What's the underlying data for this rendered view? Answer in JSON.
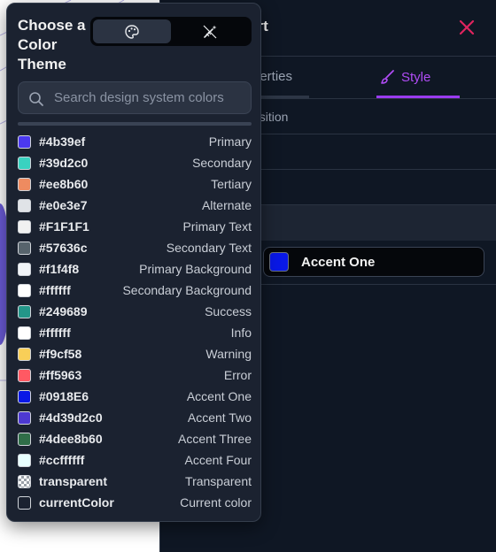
{
  "panel": {
    "title": "art",
    "tabs": [
      {
        "label": "perties"
      },
      {
        "label": "Style"
      }
    ],
    "rows": [
      {
        "label": "osition"
      },
      {
        "label": "n"
      }
    ],
    "color_field": {
      "label": "Accent One",
      "color": "#0918E6"
    }
  },
  "popover": {
    "title": "Choose a Color Theme",
    "search": {
      "placeholder": "Search design system colors",
      "value": ""
    },
    "colors": [
      {
        "hex": "#4b39ef",
        "name": "Primary",
        "swatch": "#4b39ef"
      },
      {
        "hex": "#39d2c0",
        "name": "Secondary",
        "swatch": "#39d2c0"
      },
      {
        "hex": "#ee8b60",
        "name": "Tertiary",
        "swatch": "#ee8b60"
      },
      {
        "hex": "#e0e3e7",
        "name": "Alternate",
        "swatch": "#e0e3e7"
      },
      {
        "hex": "#F1F1F1",
        "name": "Primary Text",
        "swatch": "#F1F1F1"
      },
      {
        "hex": "#57636c",
        "name": "Secondary Text",
        "swatch": "#57636c"
      },
      {
        "hex": "#f1f4f8",
        "name": "Primary Background",
        "swatch": "#f1f4f8"
      },
      {
        "hex": "#ffffff",
        "name": "Secondary Background",
        "swatch": "#ffffff"
      },
      {
        "hex": "#249689",
        "name": "Success",
        "swatch": "#249689"
      },
      {
        "hex": "#ffffff",
        "name": "Info",
        "swatch": "#ffffff"
      },
      {
        "hex": "#f9cf58",
        "name": "Warning",
        "swatch": "#f9cf58"
      },
      {
        "hex": "#ff5963",
        "name": "Error",
        "swatch": "#ff5963"
      },
      {
        "hex": "#0918E6",
        "name": "Accent One",
        "swatch": "#0918E6"
      },
      {
        "hex": "#4d39d2c0",
        "name": "Accent Two",
        "swatch": "#4d39d2"
      },
      {
        "hex": "#4dee8b60",
        "name": "Accent Three",
        "swatch": "#2f6e48"
      },
      {
        "hex": "#ccffffff",
        "name": "Accent Four",
        "swatch": "#e8ffff"
      },
      {
        "hex": "transparent",
        "name": "Transparent",
        "swatch": "checker"
      },
      {
        "hex": "currentColor",
        "name": "Current color",
        "swatch": "current"
      }
    ]
  },
  "colors": {
    "panel_bg": "#0f1724",
    "popover_bg": "#1b2230",
    "accent_purple": "#9a3cf0",
    "close_red": "#e0245e"
  }
}
